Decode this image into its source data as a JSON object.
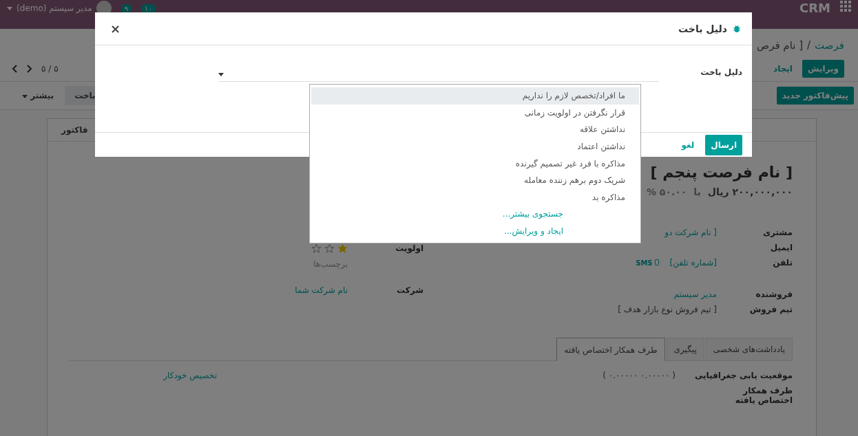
{
  "navbar": {
    "app": "CRM",
    "user": "مدیر سیستم (demo)",
    "badges": [
      "۱۰",
      "۹"
    ]
  },
  "breadcrumb": {
    "parent": "فرصت",
    "separator": "/",
    "current": "[ نام فرص"
  },
  "actions": [
    {
      "label": "ویرایش",
      "kind": "primary"
    },
    {
      "label": "ایجاد",
      "kind": "link"
    }
  ],
  "pager": "۵ / ۵",
  "header_buttons": [
    "پیش‌فاکتور جدید"
  ],
  "statusbar": [
    {
      "label": "باخت",
      "kind": "stage"
    },
    {
      "label": "بیشتر",
      "kind": "more"
    }
  ],
  "sheet": {
    "smart_button": "فاکتور",
    "title": "[ نام فرصت پنجم ]",
    "revenue": "۲۰۰,۰۰۰,۰۰۰ ریال",
    "at": "با",
    "probability": "۵۰.۰۰ %",
    "fields_right": [
      {
        "label": "مشتری",
        "value": "[ نام شرکت دو",
        "kind": "link"
      },
      {
        "label": "ایمیل",
        "kind": "text"
      },
      {
        "label": "تلفن",
        "value": "[شماره تلفن]",
        "kind": "phone",
        "sms": "SMS"
      },
      {
        "label": "فروشنده",
        "value": "مدیر سیستم",
        "kind": "link"
      },
      {
        "label": "تیم فروش",
        "value": "[ تیم فروش نوع بازار هدف ]",
        "kind": "text"
      }
    ],
    "priority": {
      "label": "اولویت",
      "stars": 1
    },
    "tags": {
      "placeholder": "برچسب‌ها"
    },
    "company": {
      "label": "شرکت",
      "value": "نام شرکت شما"
    }
  },
  "notebook": {
    "tabs": [
      {
        "label": "یادداشت‌های شخصی",
        "selected": false
      },
      {
        "label": "پیگیری",
        "selected": false
      },
      {
        "label": "طرف همکار اختصاص یافته",
        "selected": true
      }
    ],
    "geo_label": "موقعیت یابی جغرافیایی",
    "geo_value": "( ۰.۰۰۰۰۰ ۰.۰۰۰۰۰ )",
    "auto_assign": "تخصیص خودکار",
    "assigned_label": "طرف همکار اختصاص یافته"
  },
  "modal": {
    "title": "دلیل باخت",
    "close": "×",
    "field_label": "دلیل باخت",
    "buttons": [
      {
        "label": "ارسال",
        "kind": "primary"
      },
      {
        "label": "لغو",
        "kind": "link"
      }
    ],
    "dropdown": [
      {
        "label": "ما افراد/تخصص لازم را نداریم",
        "kind": "option",
        "selected": true
      },
      {
        "label": "قرار نگرفتن در اولویت زمانی",
        "kind": "option",
        "selected": false
      },
      {
        "label": "نداشتن علاقه",
        "kind": "option",
        "selected": false
      },
      {
        "label": "نداشتن اعتماد",
        "kind": "option",
        "selected": false
      },
      {
        "label": "مذاکره با فرد غیر تصمیم گیرنده",
        "kind": "option",
        "selected": false
      },
      {
        "label": "شریک دوم برهم زننده معامله",
        "kind": "option",
        "selected": false
      },
      {
        "label": "مذاکره بد",
        "kind": "option",
        "selected": false
      },
      {
        "label": "جستجوی بیشتر...",
        "kind": "action",
        "selected": false
      },
      {
        "label": "ایجاد و ویرایش...",
        "kind": "action",
        "selected": false
      }
    ]
  }
}
